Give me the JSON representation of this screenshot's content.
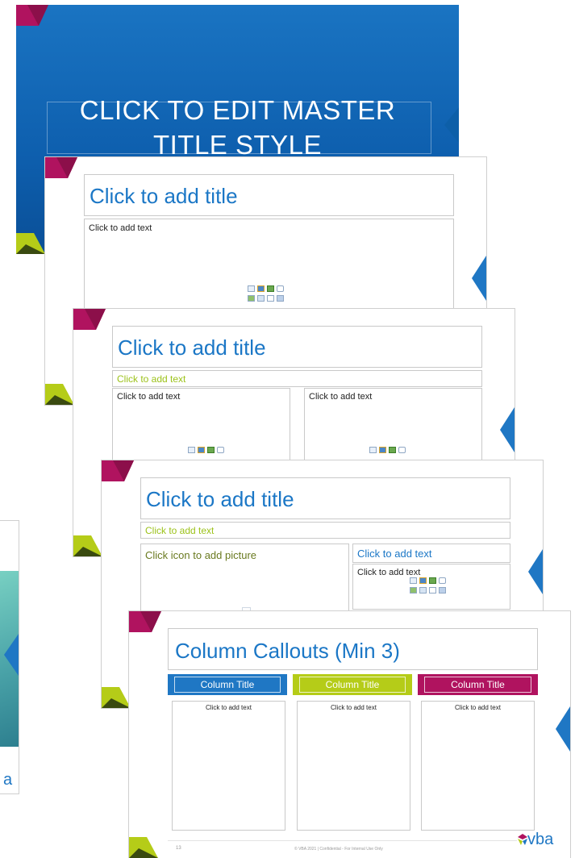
{
  "master": {
    "title_line1": "CLICK TO EDIT MASTER",
    "title_line2": "TITLE STYLE"
  },
  "layout_title_content": {
    "title": "Click to add title",
    "body": "Click to add text"
  },
  "layout_two_content": {
    "title": "Click to add title",
    "subtitle": "Click to add text",
    "left_body": "Click to add text",
    "right_body": "Click to add text"
  },
  "layout_picture_text": {
    "title": "Click to add title",
    "subtitle": "Click to add text",
    "picture": "Click icon to add picture",
    "right_heading": "Click to add text",
    "right_body": "Click to add text"
  },
  "layout_columns": {
    "title": "Column Callouts (Min 3)",
    "columns": [
      {
        "title": "Column Title",
        "body": "Click to add text",
        "color": "#1f77c4"
      },
      {
        "title": "Column Title",
        "body": "Click to add text",
        "color": "#b5cc18"
      },
      {
        "title": "Column Title",
        "body": "Click to add text",
        "color": "#b0135f"
      }
    ],
    "page_number": "13",
    "footer": "© VBA 2021 | Confidential - For Internal Use Only",
    "logo": "vba"
  },
  "side_thumb": {
    "logo": "a"
  },
  "colors": {
    "brand_blue": "#1f77c4",
    "brand_lime": "#b5cc18",
    "brand_magenta": "#b0135f",
    "master_gradient_top": "#1a74c2",
    "master_gradient_bottom": "#0a4f97"
  },
  "icons": [
    "table-icon",
    "chart-icon",
    "smartart-icon",
    "3d-model-icon",
    "picture-icon",
    "online-picture-icon",
    "video-icon",
    "icon-insert-icon",
    "vba-logo-icon"
  ]
}
